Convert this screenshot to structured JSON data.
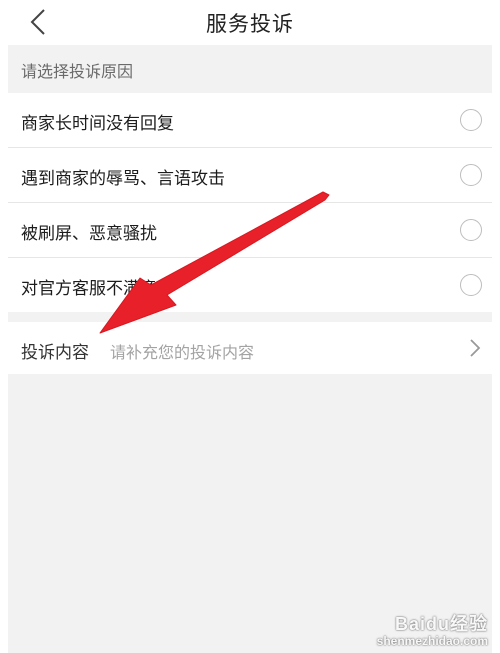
{
  "header": {
    "title": "服务投诉"
  },
  "section": {
    "title": "请选择投诉原因"
  },
  "options": [
    {
      "label": "商家长时间没有回复",
      "selected": false
    },
    {
      "label": "遇到商家的辱骂、言语攻击",
      "selected": false
    },
    {
      "label": "被刷屏、恶意骚扰",
      "selected": false
    },
    {
      "label": "对官方客服不满意",
      "selected": false
    }
  ],
  "complaint_content": {
    "label": "投诉内容",
    "placeholder": "请补充您的投诉内容"
  },
  "icons": {
    "back": "chevron-left-icon",
    "row_arrow": "chevron-right-icon",
    "annotation": "red-arrow-annotation"
  },
  "colors": {
    "annotation_arrow": "#e8202a",
    "background": "#f2f2f2",
    "radio_border": "#bdbdbd"
  },
  "watermark": {
    "brand": "Baidu经验",
    "url": "shenmezhidao.com"
  }
}
